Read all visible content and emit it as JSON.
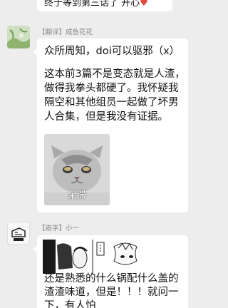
{
  "messages": [
    {
      "text": "终于等到第三话了 开心",
      "heart": "♥"
    },
    {
      "sender": "【翻译】咸鱼花花",
      "line1": "众所周知，doi可以驱邪（x）",
      "paragraph": "这本前3篇不是变态就是人渣，做得我拳头都硬了。我怀疑我隔空和其他组员一起做了坏男人合集，但是我没有证据。",
      "sticker_caption": "呆滞"
    },
    {
      "sender": "【嵌字】小一",
      "paragraph": "还是熟悉的什么锅配什么盖的渣渣味道，但是！！！就问一下，有人怕"
    }
  ],
  "colors": {
    "background": "#ededed",
    "bubble": "#ffffff",
    "sender_text": "#8a8a8a",
    "heart": "#e2463a"
  }
}
